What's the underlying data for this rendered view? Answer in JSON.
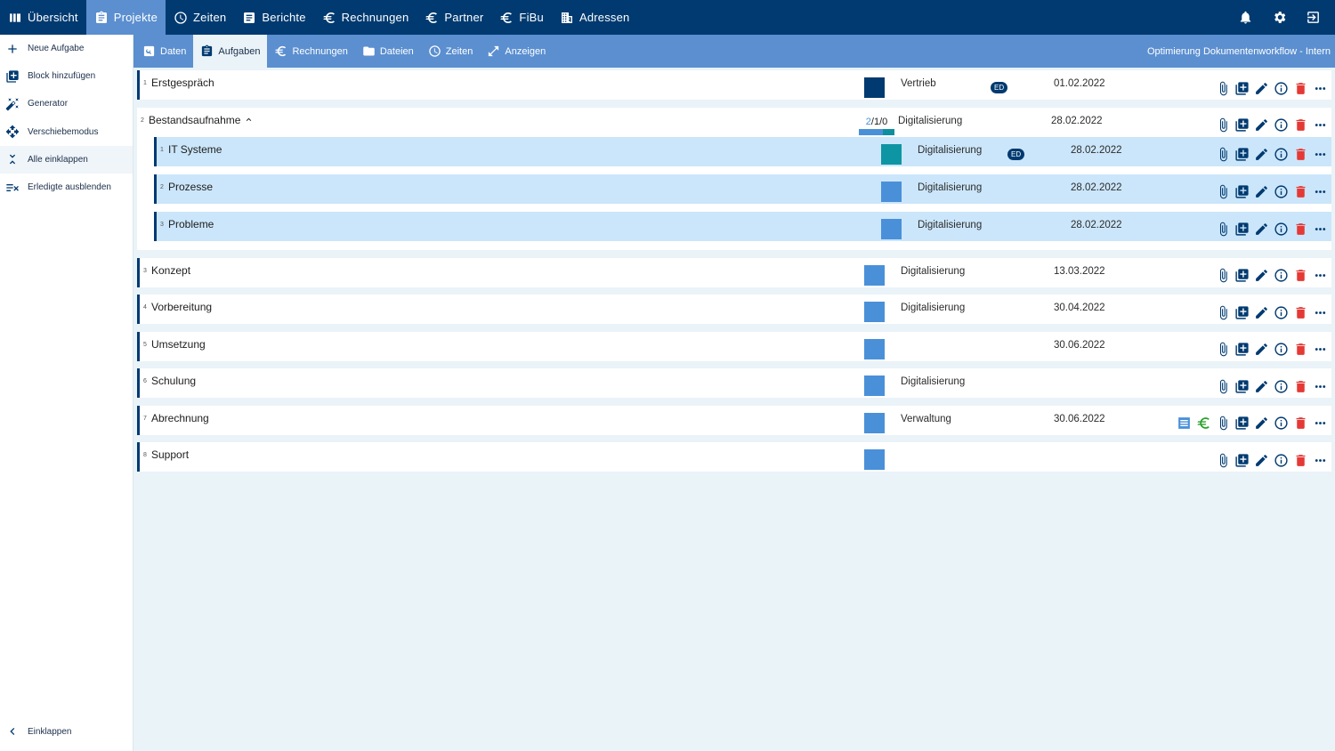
{
  "topnav": {
    "items": [
      {
        "label": "Übersicht",
        "icon": "columns-icon"
      },
      {
        "label": "Projekte",
        "icon": "clipboard-icon",
        "active": true
      },
      {
        "label": "Zeiten",
        "icon": "clock-icon"
      },
      {
        "label": "Berichte",
        "icon": "document-icon"
      },
      {
        "label": "Rechnungen",
        "icon": "euro-icon"
      },
      {
        "label": "Partner",
        "icon": "euro-icon"
      },
      {
        "label": "FiBu",
        "icon": "euro-icon"
      },
      {
        "label": "Adressen",
        "icon": "building-icon"
      }
    ],
    "right_icons": [
      "bell-icon",
      "gear-icon",
      "logout-icon"
    ]
  },
  "sidebar": {
    "items": [
      {
        "label": "Neue Aufgabe",
        "icon": "plus-icon"
      },
      {
        "label": "Block hinzufügen",
        "icon": "add-box-icon"
      },
      {
        "label": "Generator",
        "icon": "magic-wand-icon"
      },
      {
        "label": "Verschiebemodus",
        "icon": "move-icon"
      },
      {
        "label": "Alle einklappen",
        "icon": "collapse-icon"
      },
      {
        "label": "Erledigte ausblenden",
        "icon": "checklist-icon"
      }
    ],
    "collapse_label": "Einklappen"
  },
  "subnav": {
    "items": [
      {
        "label": "Daten",
        "icon": "search-doc-icon"
      },
      {
        "label": "Aufgaben",
        "icon": "clipboard-icon",
        "active": true
      },
      {
        "label": "Rechnungen",
        "icon": "euro-icon"
      },
      {
        "label": "Dateien",
        "icon": "folder-icon"
      },
      {
        "label": "Zeiten",
        "icon": "clock-icon"
      },
      {
        "label": "Anzeigen",
        "icon": "expand-icon"
      }
    ],
    "project_title": "Optimierung Dokumentenworkflow - Intern"
  },
  "tasks": [
    {
      "num": "1",
      "name": "Erstgespräch",
      "color": "#003a70",
      "dept": "Vertrieb",
      "badge": "ED",
      "date": "01.02.2022"
    },
    {
      "num": "2",
      "name": "Bestandsaufnahme",
      "expanded": true,
      "dept": "Digitalisierung",
      "date": "28.02.2022",
      "progress": {
        "done": "2",
        "open": "1",
        "other": "0",
        "colors": [
          "#4a90d9",
          "#4a90d9",
          "#0e8fa0"
        ]
      },
      "subtasks": [
        {
          "num": "1",
          "name": "IT Systeme",
          "color": "#0e95a3",
          "dept": "Digitalisierung",
          "badge": "ED",
          "date": "28.02.2022"
        },
        {
          "num": "2",
          "name": "Prozesse",
          "color": "#4a90d9",
          "dept": "Digitalisierung",
          "date": "28.02.2022"
        },
        {
          "num": "3",
          "name": "Probleme",
          "color": "#4a90d9",
          "dept": "Digitalisierung",
          "date": "28.02.2022"
        }
      ]
    },
    {
      "num": "3",
      "name": "Konzept",
      "color": "#4a90d9",
      "dept": "Digitalisierung",
      "date": "13.03.2022"
    },
    {
      "num": "4",
      "name": "Vorbereitung",
      "color": "#4a90d9",
      "dept": "Digitalisierung",
      "date": "30.04.2022"
    },
    {
      "num": "5",
      "name": "Umsetzung",
      "color": "#4a90d9",
      "dept": "",
      "date": "30.06.2022"
    },
    {
      "num": "6",
      "name": "Schulung",
      "color": "#4a90d9",
      "dept": "Digitalisierung",
      "date": ""
    },
    {
      "num": "7",
      "name": "Abrechnung",
      "color": "#4a90d9",
      "dept": "Verwaltung",
      "date": "30.06.2022",
      "extra_icons": [
        "list-icon",
        "euro-icon"
      ]
    },
    {
      "num": "8",
      "name": "Support",
      "color": "#4a90d9",
      "dept": "",
      "date": ""
    }
  ],
  "row_actions": [
    "paperclip-icon",
    "add-box-icon",
    "pencil-icon",
    "info-icon",
    "trash-icon",
    "more-icon"
  ],
  "colors": {
    "primary": "#003a70",
    "accent": "#5b8fd0",
    "light": "#cbe6fa",
    "danger": "#e53935",
    "success": "#2aa12a"
  }
}
